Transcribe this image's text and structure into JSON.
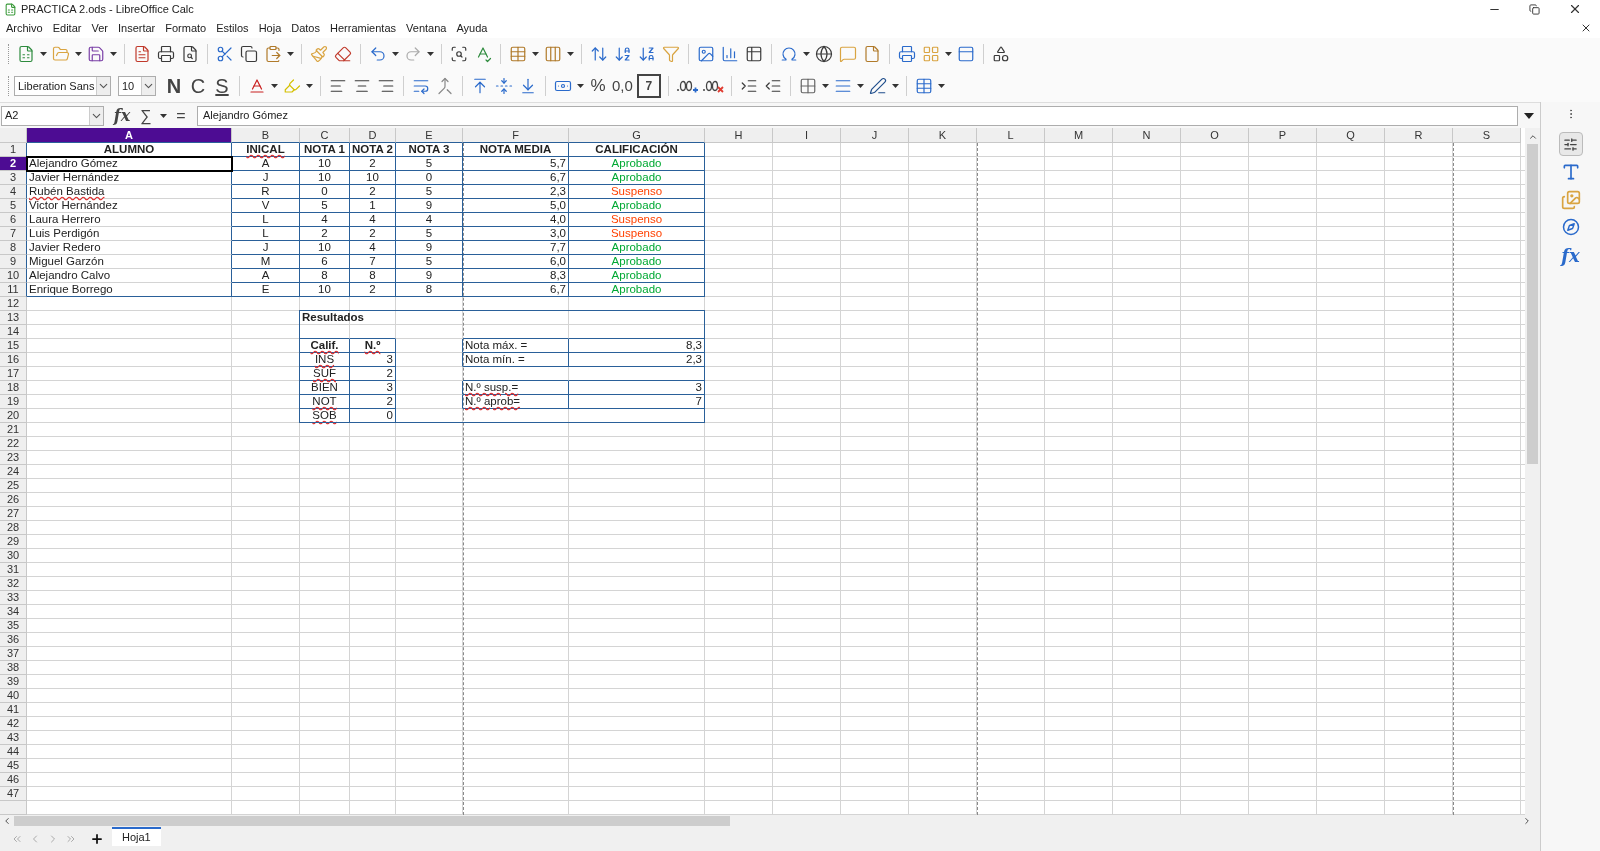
{
  "window": {
    "title": "PRACTICA 2.ods - LibreOffice Calc"
  },
  "menu": [
    "Archivo",
    "Editar",
    "Ver",
    "Insertar",
    "Formato",
    "Estilos",
    "Hoja",
    "Datos",
    "Herramientas",
    "Ventana",
    "Ayuda"
  ],
  "formatting": {
    "font_name": "Liberation Sans",
    "font_size": "10",
    "bold": "N",
    "italic": "C",
    "underline": "S",
    "percent": "%",
    "decimal": "0,0",
    "number_format": "7"
  },
  "formula_bar": {
    "cell_reference": "A2",
    "function_wizard": "fx",
    "sum": "∑",
    "equals": "=",
    "content": "Alejandro Gómez"
  },
  "sheet": {
    "columns": [
      {
        "label": "A",
        "selected": true
      },
      {
        "label": "B",
        "selected": false
      },
      {
        "label": "C",
        "selected": false
      },
      {
        "label": "D",
        "selected": false
      },
      {
        "label": "E",
        "selected": false
      },
      {
        "label": "F",
        "selected": false
      },
      {
        "label": "G",
        "selected": false
      },
      {
        "label": "H",
        "selected": false
      },
      {
        "label": "I",
        "selected": false
      },
      {
        "label": "J",
        "selected": false
      },
      {
        "label": "K",
        "selected": false
      },
      {
        "label": "L",
        "selected": false
      },
      {
        "label": "M",
        "selected": false
      },
      {
        "label": "N",
        "selected": false
      },
      {
        "label": "O",
        "selected": false
      },
      {
        "label": "P",
        "selected": false
      },
      {
        "label": "Q",
        "selected": false
      },
      {
        "label": "R",
        "selected": false
      },
      {
        "label": "S",
        "selected": false
      }
    ],
    "rows": [
      {
        "number": "1",
        "selected": false,
        "cells": [
          "ALUMNO",
          {
            "text": "INICAL",
            "misspelled": true
          },
          "NOTA 1",
          "NOTA 2",
          "NOTA 3",
          "NOTA MEDIA",
          "CALIFICACIÓN"
        ]
      },
      {
        "number": "2",
        "selected": true,
        "cells": [
          "Alejandro Gómez",
          "A",
          "10",
          "2",
          "5",
          "5,7",
          {
            "text": "Aprobado",
            "color": "#00a933"
          }
        ]
      },
      {
        "number": "3",
        "selected": false,
        "cells": [
          "Javier Hernández",
          "J",
          "10",
          "10",
          "0",
          "6,7",
          {
            "text": "Aprobado",
            "color": "#00a933"
          }
        ]
      },
      {
        "number": "4",
        "selected": false,
        "cells": [
          {
            "text": "Rubén Bastida",
            "misspelled": true
          },
          "R",
          "0",
          "2",
          "5",
          "2,3",
          {
            "text": "Suspenso",
            "color": "#ff4000"
          }
        ]
      },
      {
        "number": "5",
        "selected": false,
        "cells": [
          "Victor Hernández",
          "V",
          "5",
          "1",
          "9",
          "5,0",
          {
            "text": "Aprobado",
            "color": "#00a933"
          }
        ]
      },
      {
        "number": "6",
        "selected": false,
        "cells": [
          "Laura Herrero",
          "L",
          "4",
          "4",
          "4",
          "4,0",
          {
            "text": "Suspenso",
            "color": "#ff4000"
          }
        ]
      },
      {
        "number": "7",
        "selected": false,
        "cells": [
          "Luis Perdigón",
          "L",
          "2",
          "2",
          "5",
          "3,0",
          {
            "text": "Suspenso",
            "color": "#ff4000"
          }
        ]
      },
      {
        "number": "8",
        "selected": false,
        "cells": [
          "Javier Redero",
          "J",
          "10",
          "4",
          "9",
          "7,7",
          {
            "text": "Aprobado",
            "color": "#00a933"
          }
        ]
      },
      {
        "number": "9",
        "selected": false,
        "cells": [
          "Miguel Garzón",
          "M",
          "6",
          "7",
          "5",
          "6,0",
          {
            "text": "Aprobado",
            "color": "#00a933"
          }
        ]
      },
      {
        "number": "10",
        "selected": false,
        "cells": [
          "Alejandro Calvo",
          "A",
          "8",
          "8",
          "9",
          "8,3",
          {
            "text": "Aprobado",
            "color": "#00a933"
          }
        ]
      },
      {
        "number": "11",
        "selected": false,
        "cells": [
          "Enrique Borrego",
          "E",
          "10",
          "2",
          "8",
          "6,7",
          {
            "text": "Aprobado",
            "color": "#00a933"
          }
        ]
      },
      {
        "number": "12",
        "selected": false
      },
      {
        "number": "13",
        "selected": false,
        "cells": [
          null,
          null,
          "Resultados"
        ]
      },
      {
        "number": "14",
        "selected": false
      },
      {
        "number": "15",
        "selected": false,
        "cells": [
          null,
          null,
          {
            "text": "Calif.",
            "misspelled": true
          },
          {
            "text": "N.º",
            "misspelled": true
          },
          null,
          "Nota máx. =",
          "8,3"
        ]
      },
      {
        "number": "16",
        "selected": false,
        "cells": [
          null,
          null,
          {
            "text": "INS",
            "misspelled": true
          },
          "3",
          null,
          "Nota mín. =",
          "2,3"
        ]
      },
      {
        "number": "17",
        "selected": false,
        "cells": [
          null,
          null,
          {
            "text": "SUF",
            "misspelled": true
          },
          "2"
        ]
      },
      {
        "number": "18",
        "selected": false,
        "cells": [
          null,
          null,
          "BIEN",
          "3",
          null,
          {
            "text": "N.º susp.=",
            "misspelled": true
          },
          "3"
        ]
      },
      {
        "number": "19",
        "selected": false,
        "cells": [
          null,
          null,
          {
            "text": "NOT",
            "misspelled": true
          },
          "2",
          null,
          {
            "text": "N.º aprob=",
            "misspelled": true
          },
          "7"
        ]
      },
      {
        "number": "20",
        "selected": false,
        "cells": [
          null,
          null,
          {
            "text": "SOB",
            "misspelled": true
          },
          "0"
        ]
      },
      {
        "number": "21",
        "selected": false
      },
      {
        "number": "22",
        "selected": false
      },
      {
        "number": "23",
        "selected": false
      },
      {
        "number": "24",
        "selected": false
      },
      {
        "number": "25",
        "selected": false
      },
      {
        "number": "26",
        "selected": false
      },
      {
        "number": "27",
        "selected": false
      },
      {
        "number": "28",
        "selected": false
      },
      {
        "number": "29",
        "selected": false
      },
      {
        "number": "30",
        "selected": false
      },
      {
        "number": "31",
        "selected": false
      },
      {
        "number": "32",
        "selected": false
      },
      {
        "number": "33",
        "selected": false
      },
      {
        "number": "34",
        "selected": false
      },
      {
        "number": "35",
        "selected": false
      },
      {
        "number": "36",
        "selected": false
      },
      {
        "number": "37",
        "selected": false
      },
      {
        "number": "38",
        "selected": false
      },
      {
        "number": "39",
        "selected": false
      },
      {
        "number": "40",
        "selected": false
      },
      {
        "number": "41",
        "selected": false
      },
      {
        "number": "42",
        "selected": false
      },
      {
        "number": "43",
        "selected": false
      },
      {
        "number": "44",
        "selected": false
      },
      {
        "number": "45",
        "selected": false
      },
      {
        "number": "46",
        "selected": false
      },
      {
        "number": "47",
        "selected": false
      }
    ]
  },
  "sidebar": {
    "functions": "fx"
  },
  "sheet_tabs": [
    {
      "label": "Hoja1",
      "selected": true
    }
  ]
}
